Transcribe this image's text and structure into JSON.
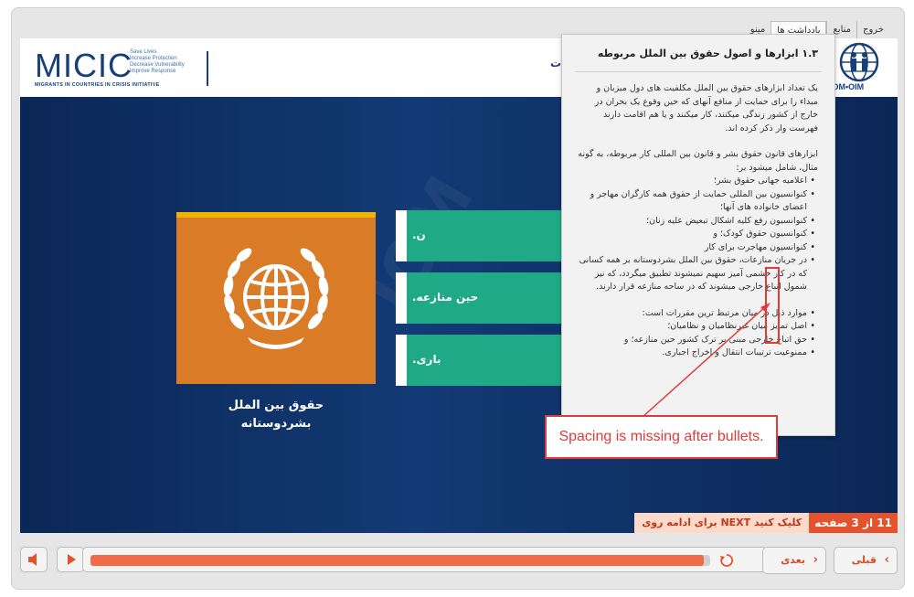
{
  "topnav": {
    "tabs": [
      {
        "label": "خروج",
        "active": false
      },
      {
        "label": "منابع",
        "active": false
      },
      {
        "label": "یادداشت ها",
        "active": true
      },
      {
        "label": "مینو",
        "active": false
      }
    ]
  },
  "header": {
    "logo_left_main": "MICIC",
    "logo_left_tagline": [
      "Save Lives",
      "Increase Protection",
      "Decrease Vulnerability",
      "Improve Response"
    ],
    "logo_left_subtitle": "MIGRANTS IN COUNTRIES IN CRISIS INITIATIVE",
    "title_fragment": "ت",
    "logo_right_text": "IOM•OIM"
  },
  "slide": {
    "card_caption_line1": "حقوق بین الملل",
    "card_caption_line2": "بشردوستانه",
    "buttons": [
      {
        "label": "ن."
      },
      {
        "label": "حین منازعه."
      },
      {
        "label": "باری."
      }
    ],
    "counter_text": "11 از 3 صفحه",
    "counter_hint": "کلیک کنید NEXT برای ادامه روی"
  },
  "notes_popup": {
    "title": "۱.۳ ابزارها و اصول حقوق بین الملل مربوطه",
    "para1": "یک تعداد ابزارهای حقوق بین الملل مکلفیت های دول میزبان و مبداء را برای حمایت از منافع آنهای که حین وقوع یک بحران در خارج از کشور زندگی میکنند، کار میکنند و یا هم اقامت دارند فهرست وار ذکر کرده اند.",
    "para2": "ابزارهای قانون حقوق بشر و قانون بین المللی کار مربوطه، به گونه مثال، شامل میشود بر:",
    "list1": [
      "اعلامیه جهانی حقوق بشر؛",
      "کنوانسیون بین المللی حمایت از حقوق همه کارگران مهاجر و اعضای خانواده های آنها؛",
      "کنوانسیون رفع کلیه اشکال تبعیض علیه زنان؛",
      "کنوانسیون حقوق کودک؛ و",
      "کنوانسیون مهاجرت برای کار",
      "در جریان منازعات، حقوق بین الملل بشردوستانه بر همه کسانی که در کار خشمی آمیز سهیم نمیشوند تطبیق میگردد، که نیز شمول اتباع خارجی میشوند که در ساحه منازعه قرار دارند."
    ],
    "para3": "موارد ذیل در میان مرتبط ترین مقررات است:",
    "list2": [
      "اصل تمایز میان غیرنظامیان و نظامیان؛",
      "حق اتباع خارجی مبنی بر ترک کشور حین منازعه؛ و",
      "ممنوعیت ترتیبات انتقال و اخراج اجباری."
    ]
  },
  "annotation": {
    "label": "Spacing is missing after bullets.",
    "color": "#e03a3a"
  },
  "controls": {
    "progress_fraction": 0.99,
    "prev_label": "قبلی",
    "next_label": "بعدی"
  },
  "colors": {
    "accent_orange": "#d97b27",
    "accent_green": "#1fa987",
    "navy": "#0d2f62",
    "progress": "#ef6b4a"
  }
}
